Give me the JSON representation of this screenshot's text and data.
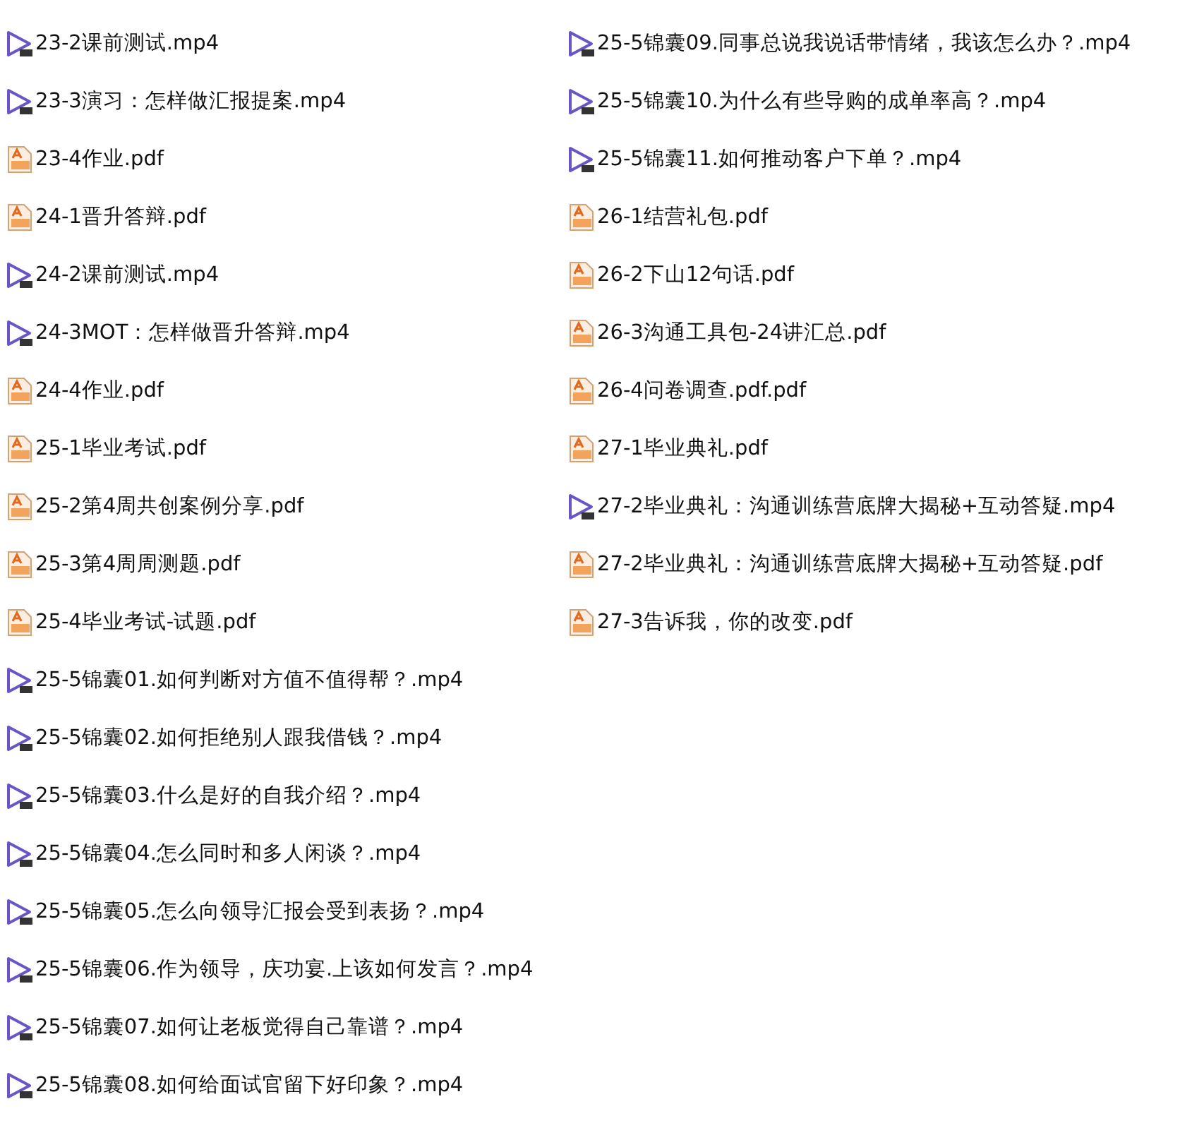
{
  "columns": [
    [
      {
        "kind": "video",
        "name": "23-2课前测试.mp4"
      },
      {
        "kind": "video",
        "name": "23-3演习：怎样做汇报提案.mp4"
      },
      {
        "kind": "pdf",
        "name": "23-4作业.pdf"
      },
      {
        "kind": "pdf",
        "name": "24-1晋升答辩.pdf"
      },
      {
        "kind": "video",
        "name": "24-2课前测试.mp4"
      },
      {
        "kind": "video",
        "name": "24-3MOT：怎样做晋升答辩.mp4"
      },
      {
        "kind": "pdf",
        "name": "24-4作业.pdf"
      },
      {
        "kind": "pdf",
        "name": "25-1毕业考试.pdf"
      },
      {
        "kind": "pdf",
        "name": "25-2第4周共创案例分享.pdf"
      },
      {
        "kind": "pdf",
        "name": "25-3第4周周测题.pdf"
      },
      {
        "kind": "pdf",
        "name": "25-4毕业考试-试题.pdf"
      },
      {
        "kind": "video",
        "name": "25-5锦囊01.如何判断对方值不值得帮？.mp4"
      },
      {
        "kind": "video",
        "name": "25-5锦囊02.如何拒绝别人跟我借钱？.mp4"
      },
      {
        "kind": "video",
        "name": "25-5锦囊03.什么是好的自我介绍？.mp4"
      },
      {
        "kind": "video",
        "name": "25-5锦囊04.怎么同时和多人闲谈？.mp4"
      },
      {
        "kind": "video",
        "name": "25-5锦囊05.怎么向领导汇报会受到表扬？.mp4"
      },
      {
        "kind": "video",
        "name": "25-5锦囊06.作为领导，庆功宴.上该如何发言？.mp4"
      },
      {
        "kind": "video",
        "name": "25-5锦囊07.如何让老板觉得自己靠谱？.mp4"
      },
      {
        "kind": "video",
        "name": "25-5锦囊08.如何给面试官留下好印象？.mp4"
      }
    ],
    [
      {
        "kind": "video",
        "name": "25-5锦囊09.同事总说我说话带情绪，我该怎么办？.mp4"
      },
      {
        "kind": "video",
        "name": "25-5锦囊10.为什么有些导购的成单率高？.mp4"
      },
      {
        "kind": "video",
        "name": "25-5锦囊11.如何推动客户下单？.mp4"
      },
      {
        "kind": "pdf",
        "name": "26-1结营礼包.pdf"
      },
      {
        "kind": "pdf",
        "name": "26-2下山12句话.pdf"
      },
      {
        "kind": "pdf",
        "name": "26-3沟通工具包-24讲汇总.pdf"
      },
      {
        "kind": "pdf",
        "name": "26-4问卷调查.pdf.pdf"
      },
      {
        "kind": "pdf",
        "name": "27-1毕业典礼.pdf"
      },
      {
        "kind": "video",
        "name": "27-2毕业典礼：沟通训练营底牌大揭秘+互动答疑.mp4"
      },
      {
        "kind": "pdf",
        "name": "27-2毕业典礼：沟通训练营底牌大揭秘+互动答疑.pdf"
      },
      {
        "kind": "pdf",
        "name": "27-3告诉我，你的改变.pdf"
      }
    ]
  ]
}
